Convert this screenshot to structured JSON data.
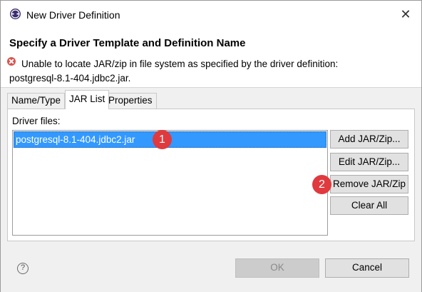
{
  "window": {
    "title": "New Driver Definition",
    "close_glyph": "✕",
    "icon": "eclipse-app-icon"
  },
  "header": {
    "title": "Specify a Driver Template and Definition Name",
    "error_line1": "Unable to locate JAR/zip in file system as specified by the driver definition:",
    "error_line2": "postgresql-8.1-404.jdbc2.jar.",
    "error_icon": "error-icon",
    "error_color": "#d9534f"
  },
  "tabs": [
    {
      "label": "Name/Type",
      "active": false
    },
    {
      "label": "JAR List",
      "active": true
    },
    {
      "label": "Properties",
      "active": false
    }
  ],
  "jar_panel": {
    "driver_files_label": "Driver files:",
    "files": [
      "postgresql-8.1-404.jdbc2.jar"
    ],
    "selection_color": "#3399ff",
    "buttons": {
      "add": "Add JAR/Zip...",
      "edit": "Edit JAR/Zip...",
      "remove": "Remove JAR/Zip",
      "clear": "Clear All"
    }
  },
  "markers": [
    "1",
    "2"
  ],
  "marker_color": "#e03a3e",
  "footer": {
    "help_glyph": "?",
    "ok_label": "OK",
    "cancel_label": "Cancel",
    "ok_enabled": false
  }
}
